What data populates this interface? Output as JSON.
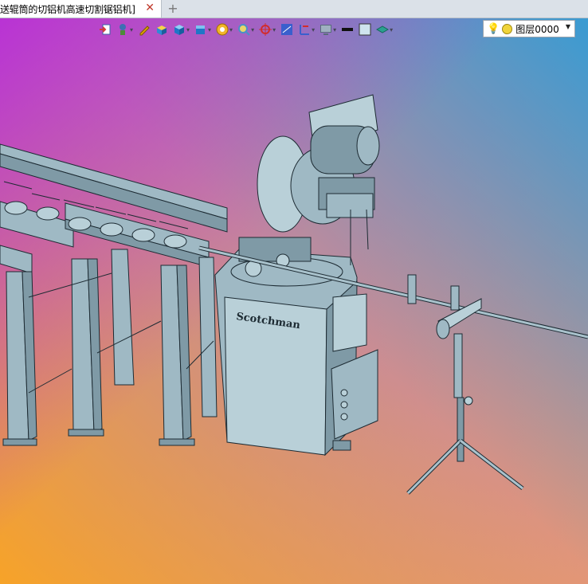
{
  "tab": {
    "title": "送辊筒的切铝机高速切割锯铝机]",
    "close": "✕",
    "new": "+"
  },
  "toolbar": {
    "items": [
      {
        "name": "exit-sketch-icon",
        "color": "#d63a3a"
      },
      {
        "name": "constraint-icon",
        "color": "#3d6fb3"
      },
      {
        "name": "pencil-icon",
        "color": "#e2a300"
      },
      {
        "name": "box-icon",
        "color": "#2d8bd6"
      },
      {
        "name": "cube-view-icon",
        "color": "#1f76c7"
      },
      {
        "name": "view-orient-icon",
        "color": "#1f76c7"
      },
      {
        "name": "render-mode-icon",
        "color": "#e0a61a"
      },
      {
        "name": "zoom-icon",
        "color": "#4a90c8"
      },
      {
        "name": "pan-icon",
        "color": "#d22c2c"
      },
      {
        "name": "section-icon",
        "color": "#3a5fcd"
      },
      {
        "name": "dimension-icon",
        "color": "#3a5fcd"
      },
      {
        "name": "display-icon",
        "color": "#5a6b7c"
      },
      {
        "name": "line-color-icon",
        "color": "#111111"
      },
      {
        "name": "fill-color-icon",
        "color": "#cfe3ee"
      },
      {
        "name": "layer-manager-icon",
        "color": "#2aa08f"
      }
    ]
  },
  "layer": {
    "value": "图层0000"
  },
  "model": {
    "brand_text": "Scotchman"
  }
}
